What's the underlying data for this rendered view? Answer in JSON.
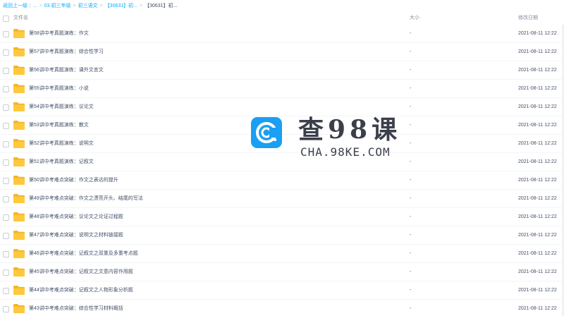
{
  "breadcrumb": {
    "back": "返回上一级",
    "separator": "|",
    "ellipsis": "...",
    "arrow": ">",
    "items": [
      "03.初三年级",
      "初三语文",
      "【30631】初..."
    ],
    "current": "【30631】初..."
  },
  "header": {
    "name": "文件名",
    "size": "大小",
    "date": "修改日期"
  },
  "rows": [
    {
      "name": "第58讲中考真题演练：作文",
      "size": "-",
      "date": "2021-08-11 12:22"
    },
    {
      "name": "第57讲中考真题演练：综合性学习",
      "size": "-",
      "date": "2021-08-11 12:22"
    },
    {
      "name": "第56讲中考真题演练：课外文言文",
      "size": "-",
      "date": "2021-08-11 12:22"
    },
    {
      "name": "第55讲中考真题演练：小说",
      "size": "-",
      "date": "2021-08-11 12:22"
    },
    {
      "name": "第54讲中考真题演练：议论文",
      "size": "-",
      "date": "2021-08-11 12:22"
    },
    {
      "name": "第53讲中考真题演练：散文",
      "size": "-",
      "date": "2021-08-11 12:22"
    },
    {
      "name": "第52讲中考真题演练：说明文",
      "size": "-",
      "date": "2021-08-11 12:22"
    },
    {
      "name": "第51讲中考真题演练：记叙文",
      "size": "-",
      "date": "2021-08-11 12:22"
    },
    {
      "name": "第50讲中考难点突破：作文之表达的提升",
      "size": "-",
      "date": "2021-08-11 12:22"
    },
    {
      "name": "第49讲中考难点突破：作文之漂亮开头、结尾的写法",
      "size": "-",
      "date": "2021-08-11 12:22"
    },
    {
      "name": "第48讲中考难点突破：议论文之论证过程题",
      "size": "-",
      "date": "2021-08-11 12:22"
    },
    {
      "name": "第47讲中考难点突破：说明文之材料链接题",
      "size": "-",
      "date": "2021-08-11 12:22"
    },
    {
      "name": "第46讲中考难点突破：记叙文之双重及多重考点题",
      "size": "-",
      "date": "2021-08-11 12:22"
    },
    {
      "name": "第45讲中考难点突破：记叙文之文意内容作用题",
      "size": "-",
      "date": "2021-08-11 12:22"
    },
    {
      "name": "第44讲中考难点突破：记叙文之人物形象分析题",
      "size": "-",
      "date": "2021-08-11 12:22"
    },
    {
      "name": "第43讲中考难点突破：综合性学习材料概括",
      "size": "-",
      "date": "2021-08-11 12:22"
    }
  ],
  "icons": {
    "folder": "folder-icon",
    "checkbox": "checkbox-icon"
  },
  "colors": {
    "link": "#09aaff",
    "folder": "#ffc83d",
    "folder_dark": "#f5b527",
    "text": "#424e67",
    "muted": "#878c9c",
    "watermark_blue": "#1a9ff2"
  },
  "watermark": {
    "title": "查98课",
    "url": "CHA.98KE.COM"
  }
}
